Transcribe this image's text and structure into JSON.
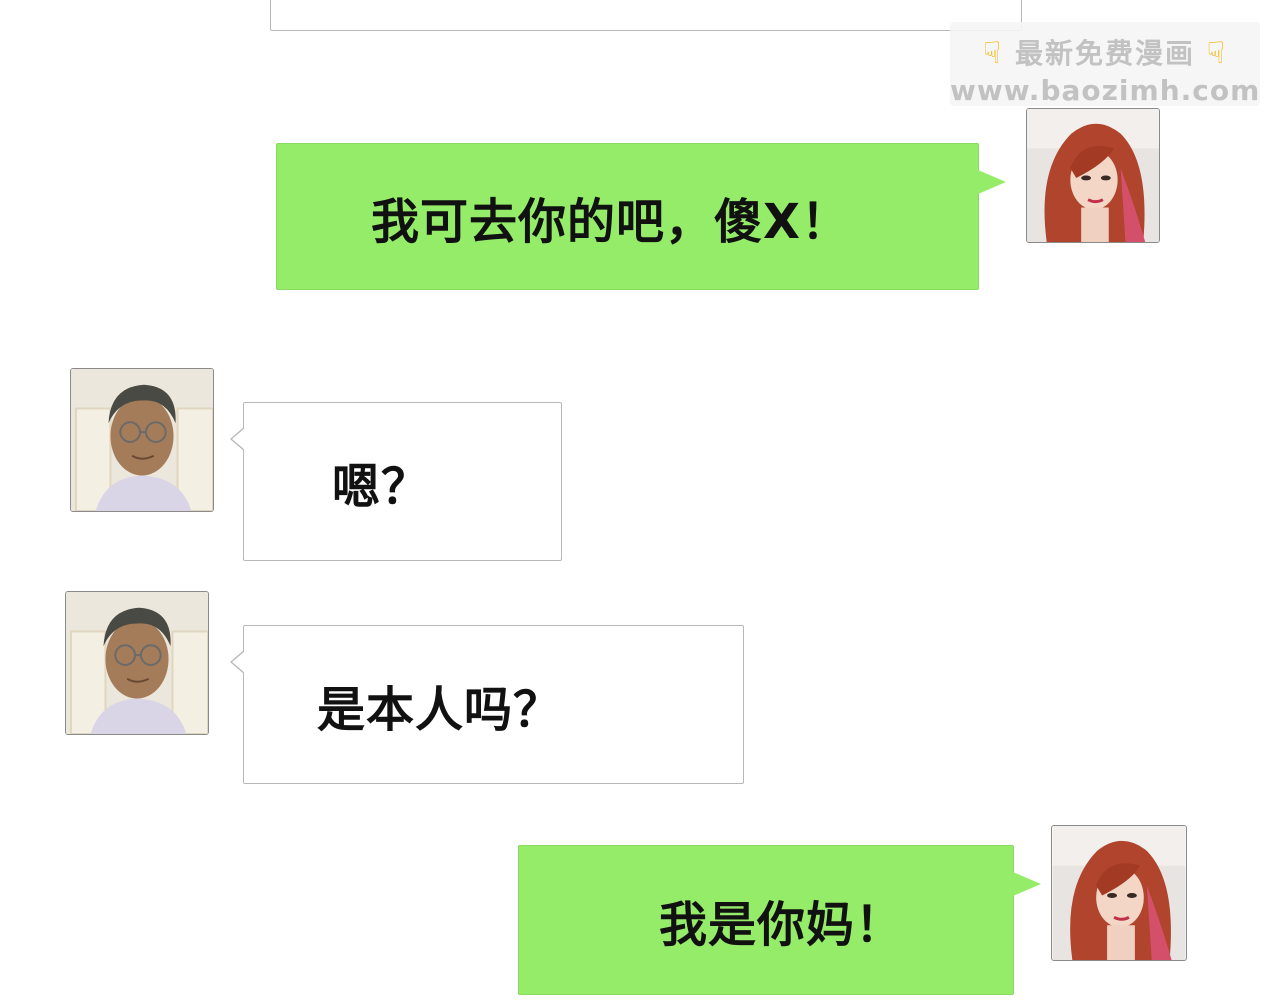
{
  "watermark": {
    "title": "最新免费漫画",
    "url": "www.baozimh.com",
    "icon": "pointing-hand-icon"
  },
  "messages": [
    {
      "speaker": "woman",
      "side": "right",
      "text": "我可去你的吧，傻X！"
    },
    {
      "speaker": "man",
      "side": "left",
      "text": "嗯？"
    },
    {
      "speaker": "man",
      "side": "left",
      "text": "是本人吗？"
    },
    {
      "speaker": "woman",
      "side": "right",
      "text": "我是你妈！"
    }
  ],
  "colors": {
    "outgoing_bubble": "#95ec69",
    "incoming_bubble": "#ffffff",
    "bubble_border": "#b8b8b8"
  }
}
